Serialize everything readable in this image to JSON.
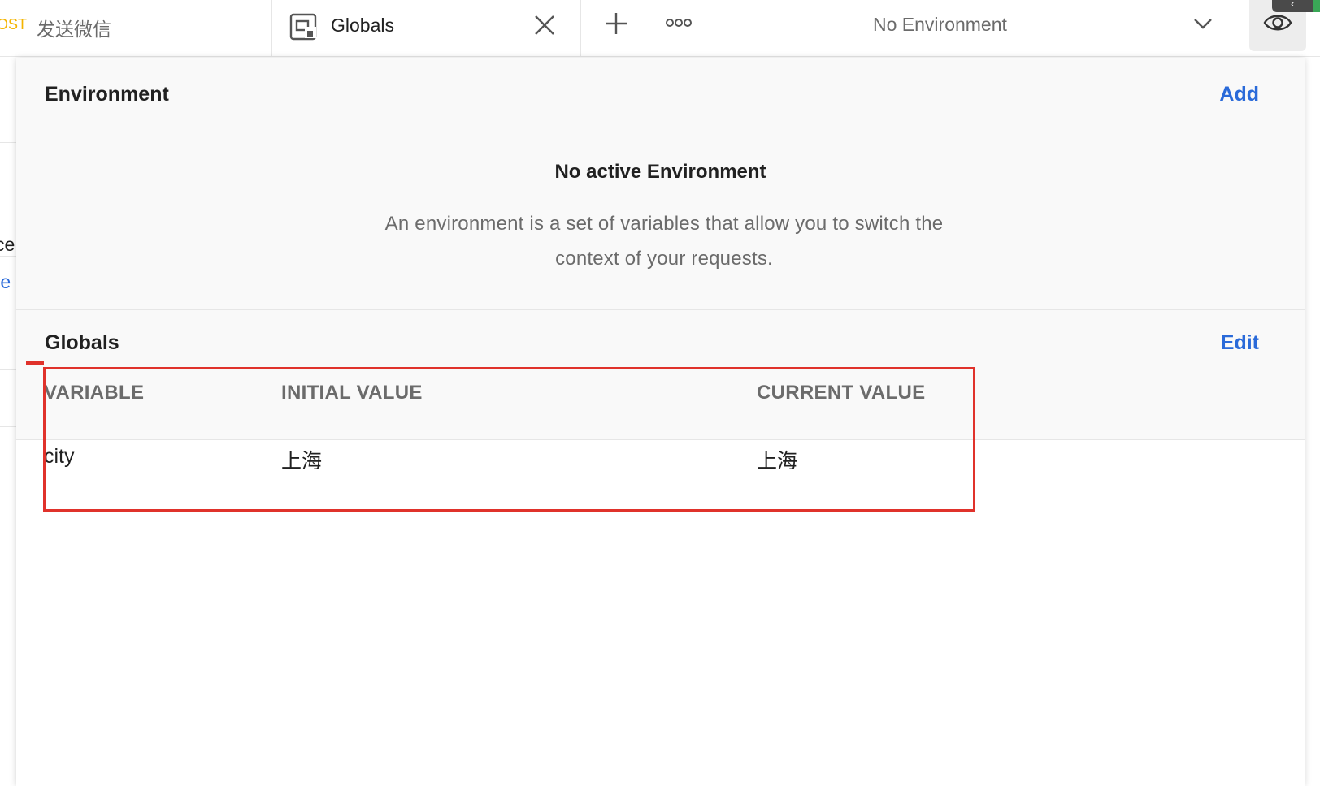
{
  "tabs": {
    "request_method": "OST",
    "request_name": "发送微信",
    "globals_label": "Globals"
  },
  "environment_selector": {
    "value": "No Environment"
  },
  "left_fragments": {
    "line1": "ce",
    "line2": ".e"
  },
  "environment_section": {
    "title": "Environment",
    "action": "Add",
    "empty_title": "No active Environment",
    "empty_desc_line1": "An environment is a set of variables that allow you to switch the",
    "empty_desc_line2": "context of your requests."
  },
  "globals_section": {
    "title": "Globals",
    "action": "Edit",
    "columns": [
      "VARIABLE",
      "INITIAL VALUE",
      "CURRENT VALUE"
    ],
    "rows": [
      [
        "city",
        "上海",
        "上海"
      ]
    ]
  },
  "colors": {
    "accent_blue": "#2a6ad9",
    "highlight_red": "#e0322b",
    "method_orange": "#f4b400"
  },
  "icons": [
    "globals-icon",
    "close-icon",
    "plus-icon",
    "more-icon",
    "chevron-down-icon",
    "eye-icon"
  ]
}
